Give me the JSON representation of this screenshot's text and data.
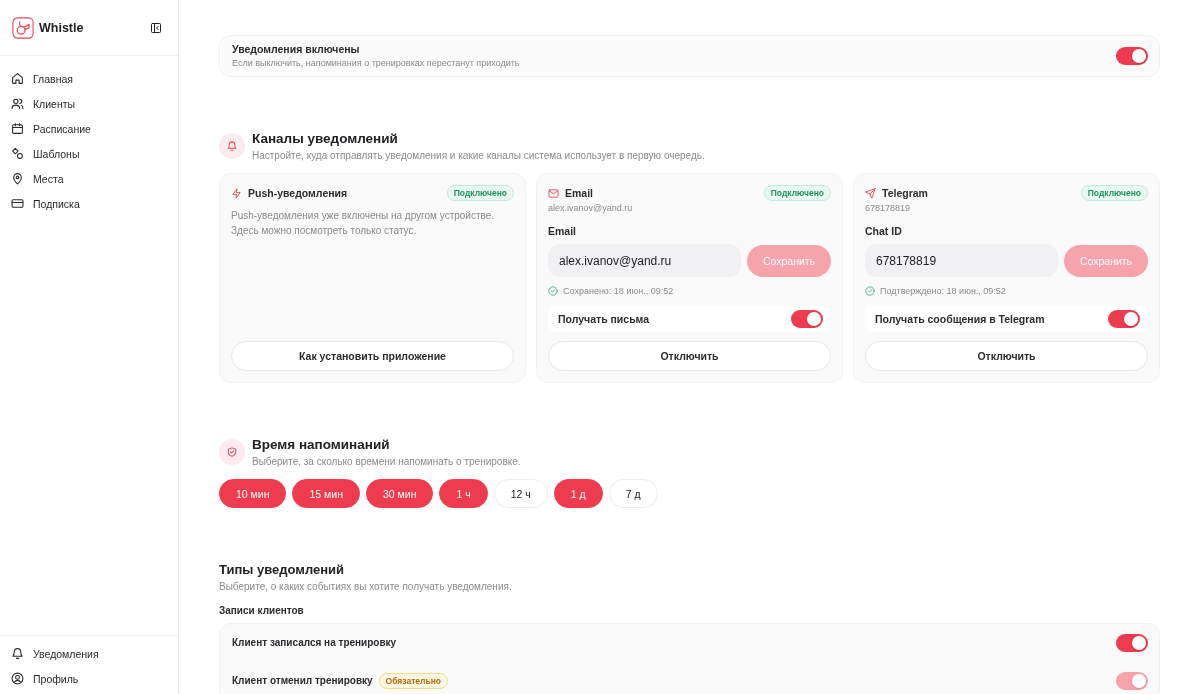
{
  "sidebar": {
    "brand": "Whistle",
    "nav_items": [
      {
        "label": "Главная",
        "selected": false
      },
      {
        "label": "Клиенты",
        "selected": false
      },
      {
        "label": "Расписание",
        "selected": false
      },
      {
        "label": "Шаблоны",
        "selected": false
      },
      {
        "label": "Места",
        "selected": false
      },
      {
        "label": "Подписка",
        "selected": false
      }
    ],
    "bottom_items": [
      {
        "label": "Уведомления",
        "selected": false
      },
      {
        "label": "Профиль",
        "selected": false
      }
    ]
  },
  "master_switch": {
    "title": "Уведомления включены",
    "description": "Если выключить, напоминания о тренировках перестанут приходить",
    "on": true
  },
  "channels": {
    "title": "Каналы уведомлений",
    "description": "Настройте, куда отправлять уведомления и какие каналы система использует в первую очередь.",
    "cards": [
      {
        "kind": "info",
        "name": "Push-уведомления",
        "status": "Подключено",
        "description": "Push-уведомления уже включены на другом устройстве. Здесь можно посмотреть только статус.",
        "button": "Как установить приложение"
      },
      {
        "kind": "form",
        "name": "Email",
        "status": "Подключено",
        "subtitle": "alex.ivanov@yand.ru",
        "field_label": "Email",
        "field_value": "alex.ivanov@yand.ru",
        "save": {
          "label": "Сохранить",
          "disabled": true
        },
        "note": "Сохранено: 18 июн., 09:52",
        "toggle": {
          "label": "Получать письма",
          "on": true
        },
        "button": "Отключить"
      },
      {
        "kind": "form",
        "name": "Telegram",
        "status": "Подключено",
        "subtitle": "678178819",
        "field_label": "Chat ID",
        "field_value": "678178819",
        "save": {
          "label": "Сохранить",
          "disabled": true
        },
        "note": "Подтверждено: 18 июн., 09:52",
        "toggle": {
          "label": "Получать сообщения в Telegram",
          "on": true
        },
        "button": "Отключить"
      }
    ]
  },
  "reminders": {
    "title": "Время напоминаний",
    "description": "Выберите, за сколько времени напоминать о тренировке.",
    "options": [
      {
        "label": "10 мин",
        "selected": true
      },
      {
        "label": "15 мин",
        "selected": true
      },
      {
        "label": "30 мин",
        "selected": true
      },
      {
        "label": "1 ч",
        "selected": true
      },
      {
        "label": "12 ч",
        "selected": false
      },
      {
        "label": "1 д",
        "selected": true
      },
      {
        "label": "7 д",
        "selected": false
      }
    ]
  },
  "notification_types": {
    "title": "Типы уведомлений",
    "description": "Выберите, о каких событиях вы хотите получать уведомления.",
    "groups": [
      {
        "title": "Записи клиентов",
        "rows": [
          {
            "label": "Клиент записался на тренировку",
            "on": true,
            "disabled": false
          },
          {
            "label": "Клиент отменил тренировку",
            "badge": "Обязательно",
            "on": true,
            "disabled": true
          }
        ]
      }
    ]
  }
}
